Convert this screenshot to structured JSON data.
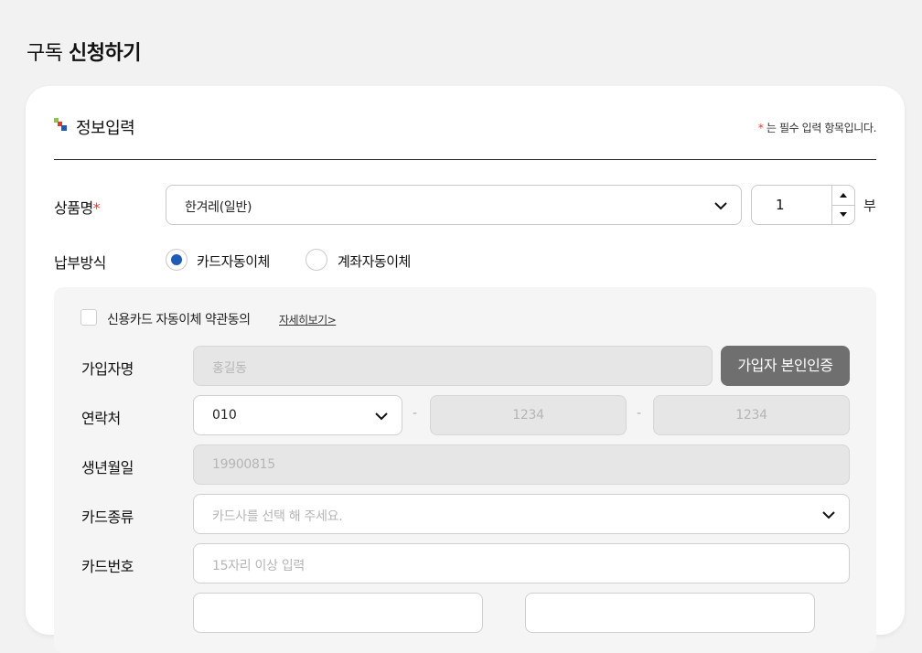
{
  "page": {
    "title_prefix": "구독",
    "title_strong": "신청하기"
  },
  "section": {
    "title": "정보입력",
    "required_star": "*",
    "required_note": " 는 필수 입력 항목입니다."
  },
  "product": {
    "label": "상품명",
    "star": "*",
    "selected": "한겨레(일반)",
    "quantity": "1",
    "unit": "부"
  },
  "payment": {
    "label": "납부방식",
    "options": [
      {
        "label": "카드자동이체",
        "selected": true
      },
      {
        "label": "계좌자동이체",
        "selected": false
      }
    ]
  },
  "card_form": {
    "agree_label": "신용카드 자동이체 약관동의",
    "detail_link": "자세히보기>",
    "name": {
      "label": "가입자명",
      "placeholder": "홍길동"
    },
    "verify_button": "가입자 본인인증",
    "contact": {
      "label": "연락처",
      "prefix": "010",
      "dash": "-",
      "middle_placeholder": "1234",
      "last_placeholder": "1234"
    },
    "birth": {
      "label": "생년월일",
      "placeholder": "19900815"
    },
    "card_type": {
      "label": "카드종류",
      "placeholder": "카드사를 선택 해 주세요."
    },
    "card_number": {
      "label": "카드번호",
      "placeholder": "15자리 이상 입력"
    }
  },
  "colors": {
    "accent_blue": "#1f5bb5",
    "required_red": "#e23b2e",
    "button_gray": "#6f6f6f",
    "page_bg": "#f2f2f2"
  },
  "icons": {
    "select": "chevron-down-icon",
    "stepper_up": "triangle-up-icon",
    "stepper_down": "triangle-down-icon",
    "section": "section-mark-icon"
  }
}
